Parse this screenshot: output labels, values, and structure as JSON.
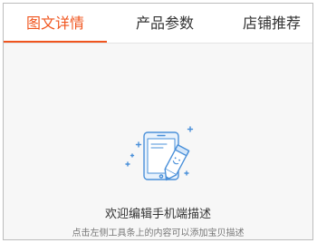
{
  "tabs": [
    {
      "label": "图文详情",
      "active": true
    },
    {
      "label": "产品参数",
      "active": false
    },
    {
      "label": "店铺推荐",
      "active": false
    }
  ],
  "colors": {
    "accent": "#f0551e",
    "illustration": "#4a90d9"
  },
  "empty_state": {
    "icon": "phone-edit-icon",
    "title": "欢迎编辑手机端描述",
    "subtitle": "点击左侧工具条上的内容可以添加宝贝描述"
  }
}
